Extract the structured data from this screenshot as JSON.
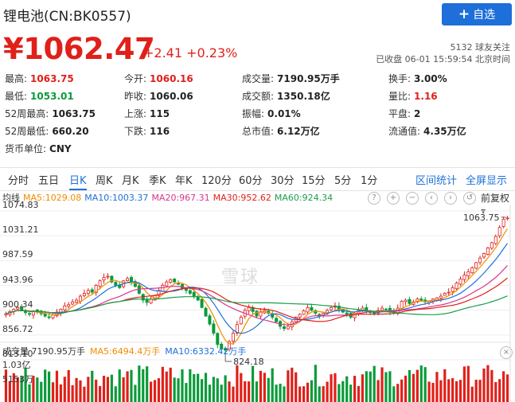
{
  "header": {
    "title": "锂电池(CN:BK0557)",
    "follow_label": "自选",
    "price": "¥1062.47",
    "change": "+2.41  +0.23%",
    "followers": "5132  球友关注",
    "status": "已收盘  06-01  15:59:54  北京时间"
  },
  "quotes": [
    {
      "label": "最高:",
      "value": "1063.75",
      "color": "red"
    },
    {
      "label": "今开:",
      "value": "1060.16",
      "color": "red"
    },
    {
      "label": "成交量:",
      "value": "7190.95万手",
      "color": ""
    },
    {
      "label": "换手:",
      "value": "3.00%",
      "color": ""
    },
    {
      "label": "最低:",
      "value": "1053.01",
      "color": "green"
    },
    {
      "label": "昨收:",
      "value": "1060.06",
      "color": ""
    },
    {
      "label": "成交额:",
      "value": "1350.18亿",
      "color": ""
    },
    {
      "label": "量比:",
      "value": "1.16",
      "color": "red"
    },
    {
      "label": "52周最高:",
      "value": "1063.75",
      "color": ""
    },
    {
      "label": "上涨:",
      "value": "115",
      "color": ""
    },
    {
      "label": "振幅:",
      "value": "0.01%",
      "color": ""
    },
    {
      "label": "平盘:",
      "value": "2",
      "color": ""
    },
    {
      "label": "52周最低:",
      "value": "660.20",
      "color": ""
    },
    {
      "label": "下跌:",
      "value": "116",
      "color": ""
    },
    {
      "label": "总市值:",
      "value": "6.12万亿",
      "color": ""
    },
    {
      "label": "流通值:",
      "value": "4.35万亿",
      "color": ""
    },
    {
      "label": "货币单位:",
      "value": "CNY",
      "color": ""
    }
  ],
  "tabs": [
    "分时",
    "五日",
    "日K",
    "周K",
    "月K",
    "季K",
    "年K",
    "120分",
    "60分",
    "30分",
    "15分",
    "5分",
    "1分"
  ],
  "active_tab": "日K",
  "tab_links": [
    "区间统计",
    "全屏显示"
  ],
  "ma_legend": [
    {
      "text": "均线",
      "color": "#333333"
    },
    {
      "text": "MA5:1029.08",
      "color": "#f08c00"
    },
    {
      "text": "MA10:1003.37",
      "color": "#1e6fd9"
    },
    {
      "text": "MA20:967.31",
      "color": "#d9368b"
    },
    {
      "text": "MA30:952.62",
      "color": "#e0201a"
    },
    {
      "text": "MA60:924.34",
      "color": "#1a9e4b"
    }
  ],
  "toolbar_icons": [
    "help-icon",
    "plus-icon",
    "minus-icon",
    "chevron-left-icon",
    "chevron-right-icon",
    "reset-icon"
  ],
  "fuquan": "前复权",
  "y_ticks": [
    "1074.83",
    "1031.21",
    "987.59",
    "943.96",
    "900.34",
    "856.72",
    "813.10"
  ],
  "max_label": "1063.75",
  "min_label": "824.18",
  "watermark": "雪球",
  "volume": {
    "legend": [
      {
        "text": "成交量  7190.95万手",
        "color": "#333333"
      },
      {
        "text": "MA5:6494.4万手",
        "color": "#f08c00"
      },
      {
        "text": "MA10:6332.42万手",
        "color": "#1e6fd9"
      }
    ],
    "y_ticks": [
      "1.03亿",
      "5153万"
    ]
  },
  "colors": {
    "up": "#e0201a",
    "down": "#0a9b3a",
    "accent": "#1e6fd9"
  },
  "chart_data": {
    "type": "candlestick",
    "ylim": [
      813.1,
      1074.83
    ],
    "close_last": 1062.47,
    "high_label": 1063.75,
    "low_label": 824.18,
    "ma_last": {
      "MA5": 1029.08,
      "MA10": 1003.37,
      "MA20": 967.31,
      "MA30": 952.62,
      "MA60": 924.34
    },
    "closes": [
      894,
      898,
      902,
      905,
      900,
      896,
      893,
      899,
      897,
      894,
      890,
      888,
      892,
      897,
      902,
      908,
      910,
      915,
      918,
      925,
      930,
      935,
      932,
      944,
      952,
      958,
      960,
      950,
      944,
      940,
      952,
      956,
      950,
      942,
      930,
      918,
      914,
      920,
      926,
      935,
      944,
      950,
      954,
      950,
      946,
      939,
      935,
      930,
      925,
      918,
      905,
      890,
      876,
      860,
      840,
      832,
      830,
      845,
      860,
      875,
      888,
      900,
      905,
      898,
      890,
      897,
      900,
      895,
      888,
      880,
      872,
      868,
      872,
      880,
      888,
      893,
      899,
      905,
      900,
      895,
      890,
      895,
      900,
      905,
      908,
      902,
      897,
      893,
      888,
      895,
      900,
      904,
      899,
      896,
      894,
      900,
      904,
      902,
      898,
      896,
      904,
      916,
      918,
      912,
      915,
      920,
      918,
      915,
      916,
      920,
      922,
      925,
      930,
      932,
      940,
      948,
      955,
      962,
      968,
      975,
      984,
      992,
      1000,
      1010,
      1019,
      1030,
      1046,
      1060,
      1062.47
    ],
    "volume_ylim": [
      0,
      103000000
    ],
    "volume_last": 71909500,
    "volume_ma": {
      "MA5": 64944000,
      "MA10": 63324200
    }
  }
}
